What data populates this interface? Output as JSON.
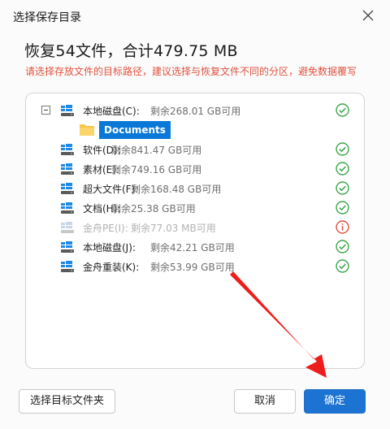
{
  "dialog": {
    "title": "选择保存目录",
    "heading": "恢复54文件，合计479.75 MB",
    "warning": "请选择存放文件的目标路径，建议选择与恢复文件不同的分区，避免数据覆写"
  },
  "tree": {
    "root": {
      "label": "本地磁盘(C):",
      "free": "剩余268.01 GB可用",
      "status": "ok"
    },
    "selected_folder": "Documents",
    "drives": [
      {
        "label": "软件(D):",
        "free": "剩余841.47 GB可用",
        "status": "ok",
        "disabled": false
      },
      {
        "label": "素材(E):",
        "free": "剩余749.16 GB可用",
        "status": "ok",
        "disabled": false
      },
      {
        "label": "超大文件(F):",
        "free": "剩余168.48 GB可用",
        "status": "ok",
        "disabled": false
      },
      {
        "label": "文档(H):",
        "free": "剩余25.38 GB可用",
        "status": "ok",
        "disabled": false
      },
      {
        "label": "金舟PE(I):",
        "free": "剩余77.03 MB可用",
        "status": "warning",
        "disabled": true
      },
      {
        "label": "本地磁盘(J):",
        "free": "剩余42.21 GB可用",
        "status": "ok",
        "disabled": false
      },
      {
        "label": "金舟重装(K):",
        "free": "剩余53.99 GB可用",
        "status": "ok",
        "disabled": false
      }
    ]
  },
  "buttons": {
    "choose_folder": "选择目标文件夹",
    "cancel": "取消",
    "confirm": "确定"
  },
  "colors": {
    "accent": "#1d73d1",
    "ok": "#3aa64a",
    "warn": "#e0523f",
    "annotation_arrow": "#ee1c1c"
  }
}
